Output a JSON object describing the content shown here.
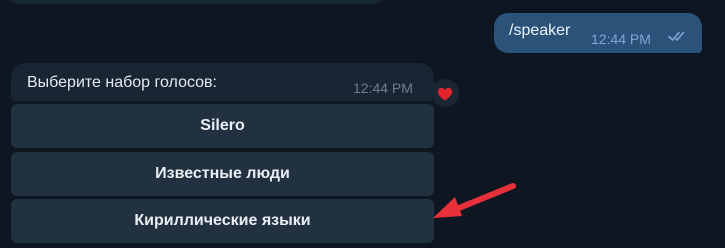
{
  "outgoing": {
    "text": "/speaker",
    "time": "12:44 PM",
    "status_icon": "double-check-icon"
  },
  "incoming": {
    "text": "Выберите набор голосов:",
    "time": "12:44 PM",
    "reaction_icon": "heart-icon",
    "reaction_color": "#e0232e"
  },
  "keyboard": {
    "buttons": [
      {
        "label": "Silero"
      },
      {
        "label": "Известные люди"
      },
      {
        "label": "Кириллические языки"
      }
    ]
  },
  "annotation": {
    "arrow_color": "#e8303a"
  }
}
